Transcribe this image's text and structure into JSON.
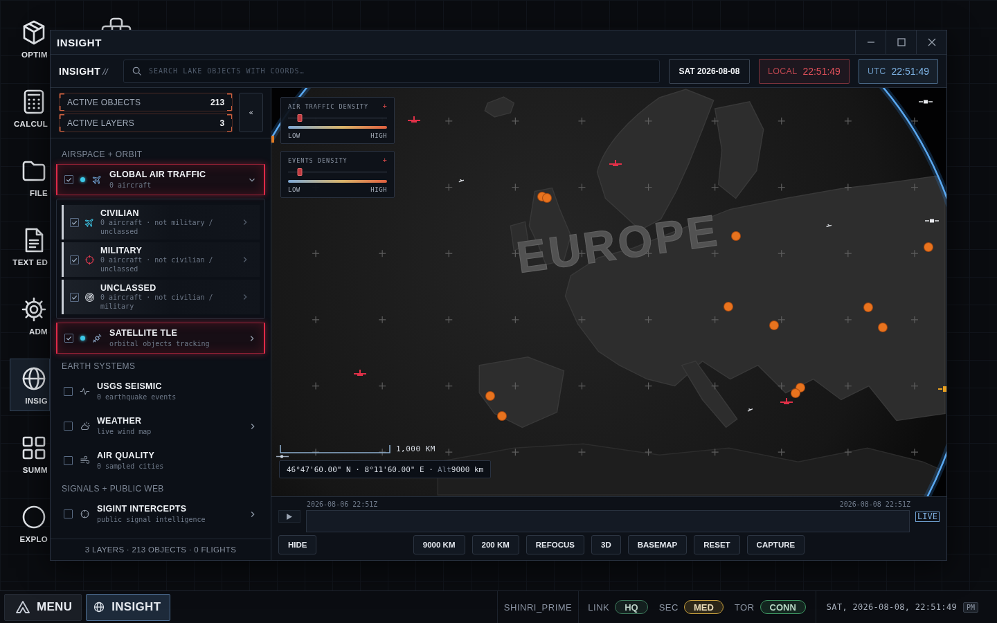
{
  "desktop_icons": [
    {
      "label": "OPTIM",
      "selected": false
    },
    {
      "label": "CALCUL",
      "selected": false
    },
    {
      "label": "FILE",
      "selected": false
    },
    {
      "label": "TEXT ED",
      "selected": false
    },
    {
      "label": "ADM",
      "selected": false
    },
    {
      "label": "INSIG",
      "selected": true
    },
    {
      "label": "SUMM",
      "selected": false
    },
    {
      "label": "EXPLO",
      "selected": false
    }
  ],
  "window": {
    "title": "INSIGHT"
  },
  "toolbar": {
    "brand": "INSIGHT",
    "brand_mark": "//",
    "search": {
      "placeholder": "SEARCH LAKE OBJECTS WITH COORDS…"
    },
    "date": "SAT 2026-08-08",
    "clocks": [
      {
        "label": "LOCAL",
        "time": "22:51:49",
        "color": "#e0505a"
      },
      {
        "label": "UTC",
        "time": "22:51:49",
        "color": "#7fb4e6"
      }
    ]
  },
  "layers_panel": {
    "stats": [
      {
        "label": "ACTIVE OBJECTS",
        "value": "213"
      },
      {
        "label": "ACTIVE LAYERS",
        "value": "3"
      }
    ],
    "collapse": "«",
    "sections": [
      {
        "title": "AIRSPACE + ORBIT",
        "layers": [
          {
            "title": "GLOBAL AIR TRAFFIC",
            "subtitle": "0 aircraft",
            "checked": true,
            "expandable": true,
            "expanded": true,
            "children": [
              {
                "title": "CIVILIAN",
                "subtitle": "0 aircraft · not military / unclassed",
                "checked": true,
                "expandable": true,
                "expanded": false
              },
              {
                "title": "MILITARY",
                "subtitle": "0 aircraft · not civilian / unclassed",
                "checked": true,
                "expandable": true,
                "expanded": false
              },
              {
                "title": "UNCLASSED",
                "subtitle": "0 aircraft · not civilian / military",
                "checked": true,
                "expandable": true,
                "expanded": false
              }
            ]
          },
          {
            "title": "SATELLITE TLE",
            "subtitle": "orbital objects tracking",
            "checked": true,
            "expandable": true,
            "expanded": false
          }
        ]
      },
      {
        "title": "EARTH SYSTEMS",
        "layers": [
          {
            "title": "USGS SEISMIC",
            "subtitle": "0 earthquake events",
            "checked": false,
            "expandable": false,
            "expanded": false
          },
          {
            "title": "WEATHER",
            "subtitle": "live wind map",
            "checked": false,
            "expandable": true,
            "expanded": false
          },
          {
            "title": "AIR QUALITY",
            "subtitle": "0 sampled cities",
            "checked": false,
            "expandable": false,
            "expanded": false
          }
        ]
      },
      {
        "title": "SIGNALS + PUBLIC WEB",
        "layers": [
          {
            "title": "SIGINT INTERCEPTS",
            "subtitle": "public signal intelligence",
            "checked": false,
            "expandable": true,
            "expanded": false
          }
        ]
      }
    ],
    "footer": "3 LAYERS · 213 OBJECTS · 0 FLIGHTS"
  },
  "map": {
    "region_label": "EUROPE",
    "legends": [
      {
        "title": "AIR TRAFFIC DENSITY",
        "plus": "+",
        "level": 0.12,
        "low": "LOW",
        "high": "HIGH"
      },
      {
        "title": "EVENTS DENSITY",
        "plus": "+",
        "level": 0.12,
        "low": "LOW",
        "high": "HIGH"
      }
    ],
    "scale": "1,000 KM",
    "position": "46°47'60.00\" N · 8°11'60.00\" E ·",
    "altitude_label": "Alt",
    "altitude": "9000 km"
  },
  "timeline": {
    "start": "2026-08-06 22:51Z",
    "end": "2026-08-08 22:51Z",
    "live": "LIVE"
  },
  "controls": {
    "hide": "HIDE",
    "buttons": [
      "9000 KM",
      "200 KM",
      "REFOCUS",
      "3D",
      "BASEMAP",
      "RESET",
      "CAPTURE"
    ]
  },
  "taskbar": {
    "tasks": [
      {
        "kind": "menu",
        "label": "MENU",
        "selected": false
      },
      {
        "kind": "app",
        "label": "INSIGHT",
        "selected": true
      }
    ],
    "host": "SHINRI_PRIME",
    "indicators": [
      {
        "label": "LINK",
        "value": "HQ",
        "color": "#3d7a5c"
      },
      {
        "label": "SEC",
        "value": "MED",
        "color": "#c9a13e"
      },
      {
        "label": "TOR",
        "value": "CONN",
        "color": "#3f9a64"
      }
    ],
    "clock": "SAT, 2026-08-08, 22:51:49",
    "meridiem": "PM"
  }
}
